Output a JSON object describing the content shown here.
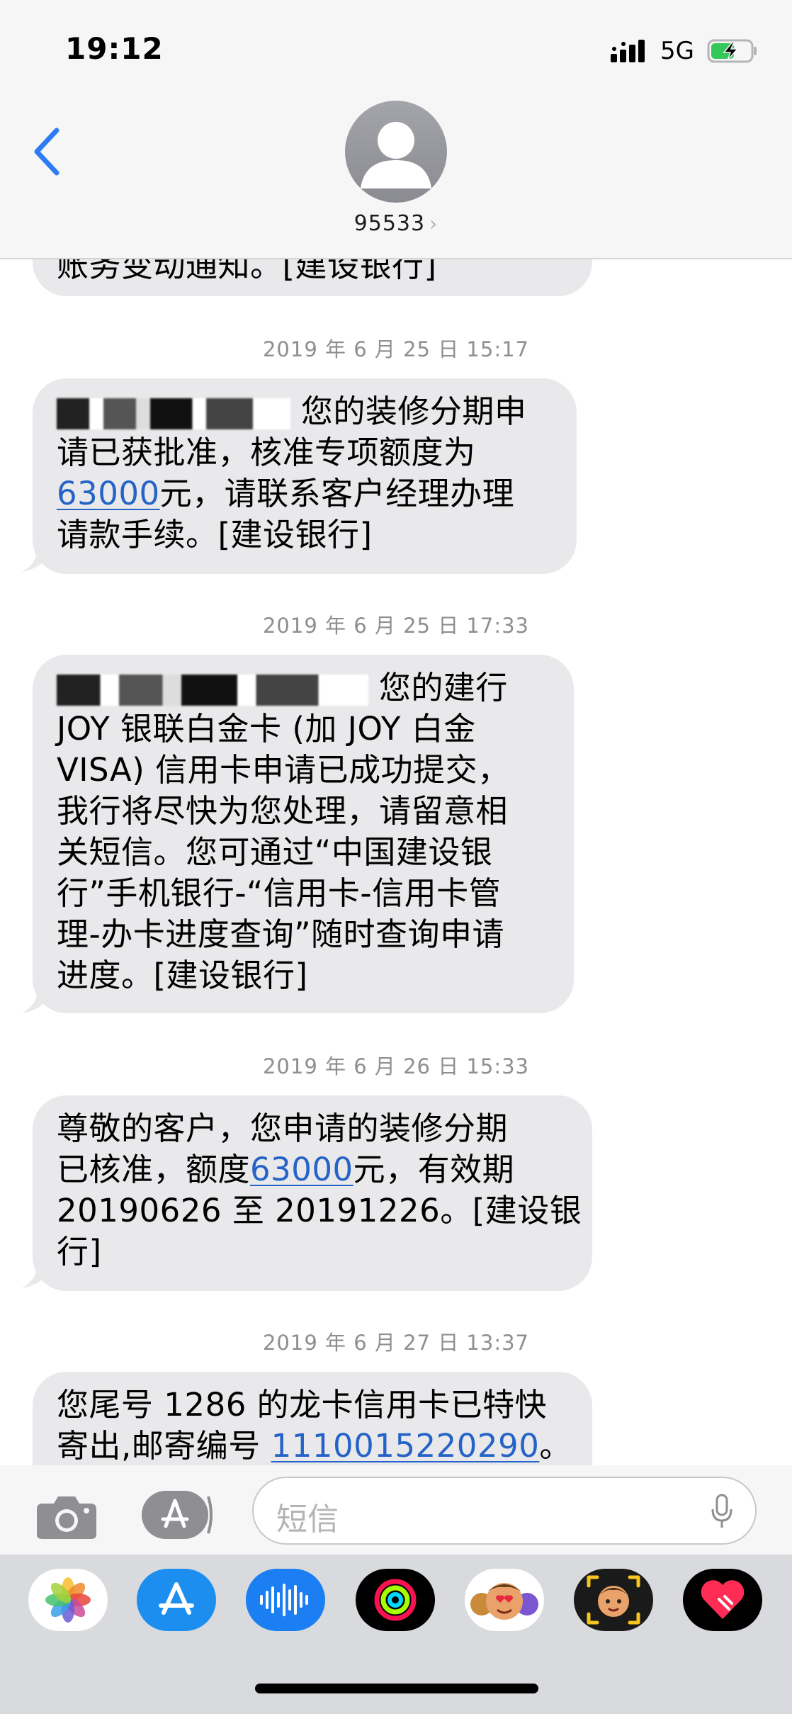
{
  "status_bar": {
    "time": "19:12",
    "network": "5G"
  },
  "contact": {
    "name": "95533",
    "chevron": "›"
  },
  "thread": {
    "partial_top": "账务变动通知。[建设银行]",
    "messages": [
      {
        "timestamp": "2019 年 6 月 25 日 15:17",
        "lines": [
          "您的装修分期申",
          "请已获批准，核准专项额度为",
          "元，请联系客户经理办理",
          "请款手续。[建设银行]"
        ],
        "link": "63000"
      },
      {
        "timestamp": "2019 年 6 月 25 日 17:33",
        "lines": [
          "您的建行",
          "JOY 银联白金卡 (加 JOY 白金",
          "VISA) 信用卡申请已成功提交，",
          "我行将尽快为您处理，请留意相",
          "关短信。您可通过“中国建设银",
          "行”手机银行-“信用卡-信用卡管",
          "理-办卡进度查询”随时查询申请",
          "进度。[建设银行]"
        ]
      },
      {
        "timestamp": "2019 年 6 月 26 日 15:33",
        "lines": [
          "尊敬的客户，您申请的装修分期",
          "已核准，额度",
          "元，有效期",
          "20190626 至 20191226。[建设银",
          "行]"
        ],
        "link": "63000"
      },
      {
        "timestamp": "2019 年 6 月 27 日 13:37",
        "lines": [
          "您尾号 1286 的龙卡信用卡已特快",
          "寄出,邮寄编号",
          "。"
        ],
        "link": "1110015220290"
      }
    ]
  },
  "input": {
    "placeholder": "短信"
  },
  "app_strip": {
    "apps": [
      "photos-icon",
      "app-store-icon",
      "audio-message-icon",
      "activity-icon",
      "memoji-icon",
      "memoji-camera-icon",
      "digital-touch-icon"
    ]
  }
}
